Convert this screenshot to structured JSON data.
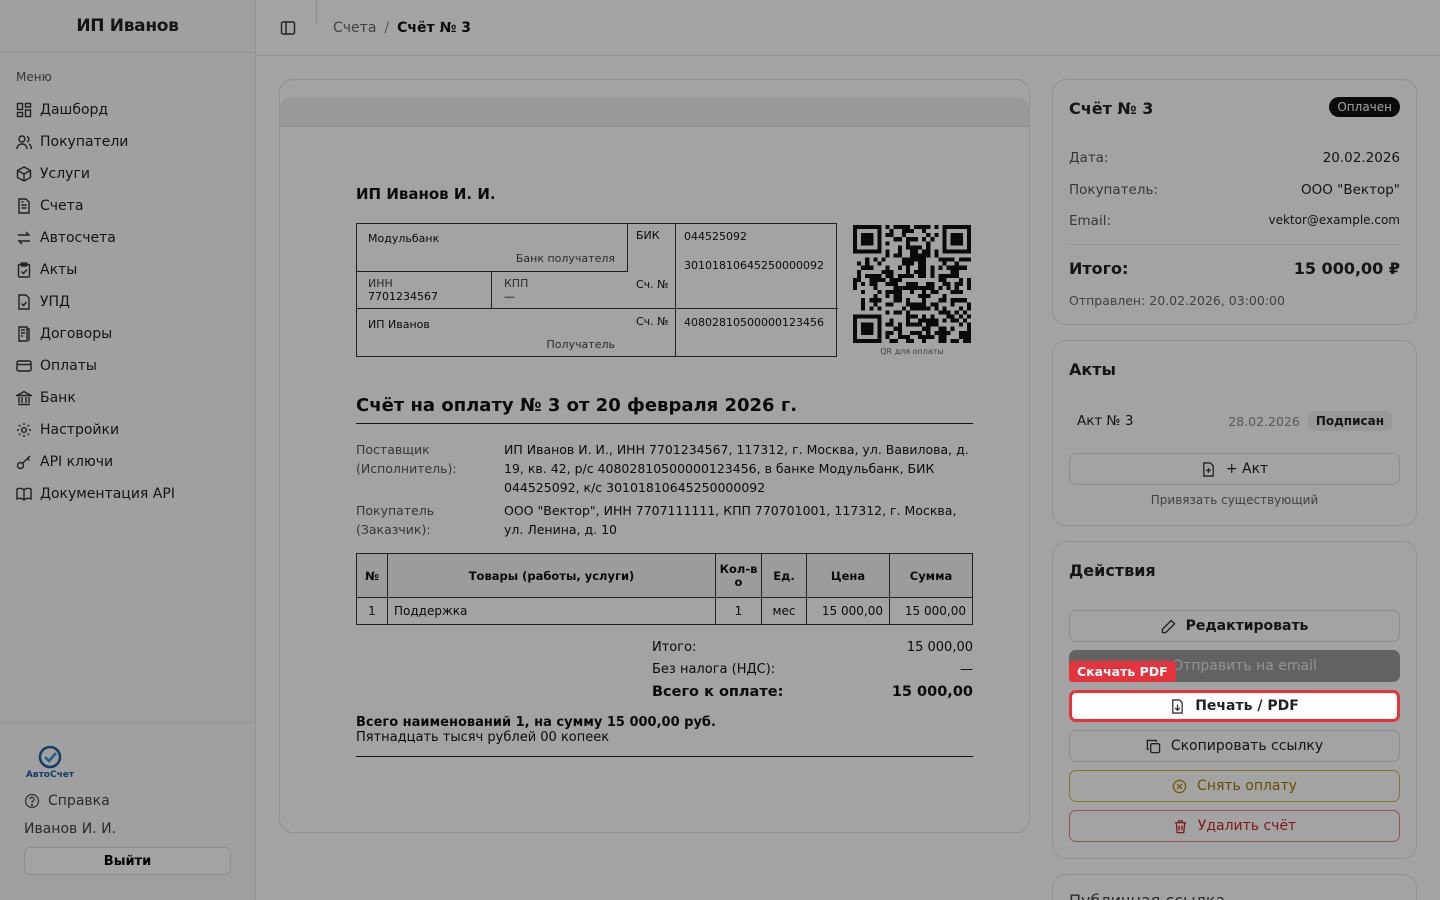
{
  "app": {
    "title": "ИП Иванов"
  },
  "sidebar": {
    "menu_caption": "Меню",
    "items": [
      {
        "label": "Дашборд",
        "icon": "dashboard-icon"
      },
      {
        "label": "Покупатели",
        "icon": "users-icon"
      },
      {
        "label": "Услуги",
        "icon": "box-icon"
      },
      {
        "label": "Счета",
        "icon": "document-icon"
      },
      {
        "label": "Автосчета",
        "icon": "repeat-icon"
      },
      {
        "label": "Акты",
        "icon": "clipboard-check-icon"
      },
      {
        "label": "УПД",
        "icon": "file-check-icon"
      },
      {
        "label": "Договоры",
        "icon": "contract-icon"
      },
      {
        "label": "Оплаты",
        "icon": "card-icon"
      },
      {
        "label": "Банк",
        "icon": "bank-icon"
      },
      {
        "label": "Настройки",
        "icon": "gear-icon"
      },
      {
        "label": "API ключи",
        "icon": "key-icon"
      },
      {
        "label": "Документация API",
        "icon": "book-icon"
      }
    ],
    "logo_text": "АвтоСчет",
    "help_label": "Справка",
    "user_name": "Иванов И. И.",
    "logout_label": "Выйти"
  },
  "breadcrumb": {
    "parent": "Счета",
    "separator": "/",
    "current": "Счёт № 3"
  },
  "invoice": {
    "issuer": "ИП Иванов И. И.",
    "bank_name": "Модульбанк",
    "bank_caption": "Банк получателя",
    "bik_label": "БИК",
    "bik": "044525092",
    "corr_account": "30101810645250000092",
    "inn_label": "ИНН",
    "inn": "7701234567",
    "kpp_label": "КПП",
    "kpp": "—",
    "acc_label_1": "Сч. №",
    "acc_label_2": "Сч. №",
    "recipient": "ИП Иванов",
    "recipient_caption": "Получатель",
    "account": "40802810500000123456",
    "qr_caption": "QR для оплаты",
    "title": "Счёт на оплату № 3 от 20 февраля 2026 г.",
    "supplier_label": "Поставщик (Исполнитель):",
    "supplier": "ИП Иванов И. И., ИНН 7701234567, 117312, г. Москва, ул. Вавилова, д. 19, кв. 42, р/с 40802810500000123456, в банке Модульбанк, БИК 044525092, к/с 30101810645250000092",
    "buyer_label": "Покупатель (Заказчик):",
    "buyer": "ООО \"Вектор\", ИНН 7707111111, КПП 770701001, 117312, г. Москва, ул. Ленина, д. 10",
    "table": {
      "headers": [
        "№",
        "Товары (работы, услуги)",
        "Кол-во",
        "Ед.",
        "Цена",
        "Сумма"
      ],
      "rows": [
        [
          "1",
          "Поддержка",
          "1",
          "мес",
          "15 000,00",
          "15 000,00"
        ]
      ]
    },
    "total_label": "Итого:",
    "total_value": "15 000,00",
    "vat_label": "Без налога (НДС):",
    "vat_value": "—",
    "grand_label": "Всего к оплате:",
    "grand_value": "15 000,00",
    "summary_line1": "Всего наименований 1, на сумму 15 000,00 руб.",
    "summary_line2": "Пятнадцать тысяч рублей 00 копеек"
  },
  "info": {
    "title": "Счёт № 3",
    "status": "Оплачен",
    "date_label": "Дата:",
    "date": "20.02.2026",
    "buyer_label": "Покупатель:",
    "buyer": "ООО \"Вектор\"",
    "email_label": "Email:",
    "email": "vektor@example.com",
    "total_label": "Итого:",
    "total": "15 000,00 ₽",
    "sent": "Отправлен: 20.02.2026, 03:00:00"
  },
  "acts": {
    "title": "Акты",
    "item_name": "Акт № 3",
    "item_date": "28.02.2026",
    "item_status": "Подписан",
    "add_label": "+ Акт",
    "link_existing": "Привязать существующий"
  },
  "actions": {
    "title": "Действия",
    "edit": "Редактировать",
    "send_email": "Отправить на email",
    "print_pdf": "Печать / PDF",
    "copy_link": "Скопировать ссылку",
    "unpay": "Снять оплату",
    "delete": "Удалить счёт",
    "tooltip": "Скачать PDF"
  },
  "public_link": {
    "title": "Публичная ссылка"
  },
  "colors": {
    "highlight": "#e5333d",
    "badge": "#111111",
    "warn": "#c99700",
    "danger": "#d12b2b"
  }
}
